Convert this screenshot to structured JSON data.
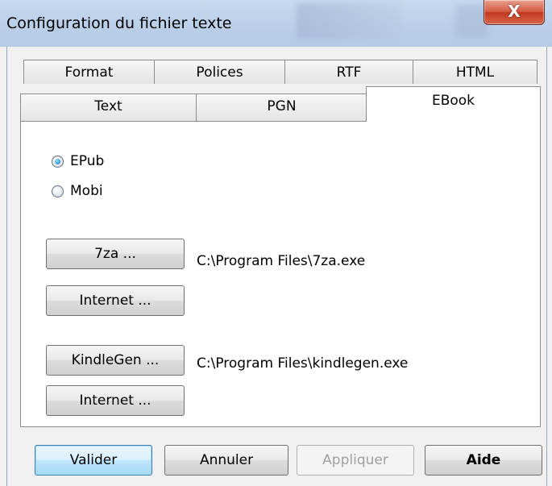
{
  "window": {
    "title": "Configuration du fichier texte",
    "close_label": "X"
  },
  "tabs": {
    "row_back": [
      "Format",
      "Polices",
      "RTF",
      "HTML"
    ],
    "row_front": [
      "Text",
      "PGN",
      "EBook"
    ],
    "active": "EBook"
  },
  "ebook": {
    "format_options": [
      {
        "label": "EPub",
        "checked": true
      },
      {
        "label": "Mobi",
        "checked": false
      }
    ],
    "zip_button": "7za ...",
    "zip_path": "C:\\Program Files\\7za.exe",
    "zip_internet_button": "Internet ...",
    "kindlegen_button": "KindleGen ...",
    "kindlegen_path": "C:\\Program Files\\kindlegen.exe",
    "kindlegen_internet_button": "Internet ..."
  },
  "footer": {
    "ok": "Valider",
    "cancel": "Annuler",
    "apply": "Appliquer",
    "help": "Aide"
  }
}
